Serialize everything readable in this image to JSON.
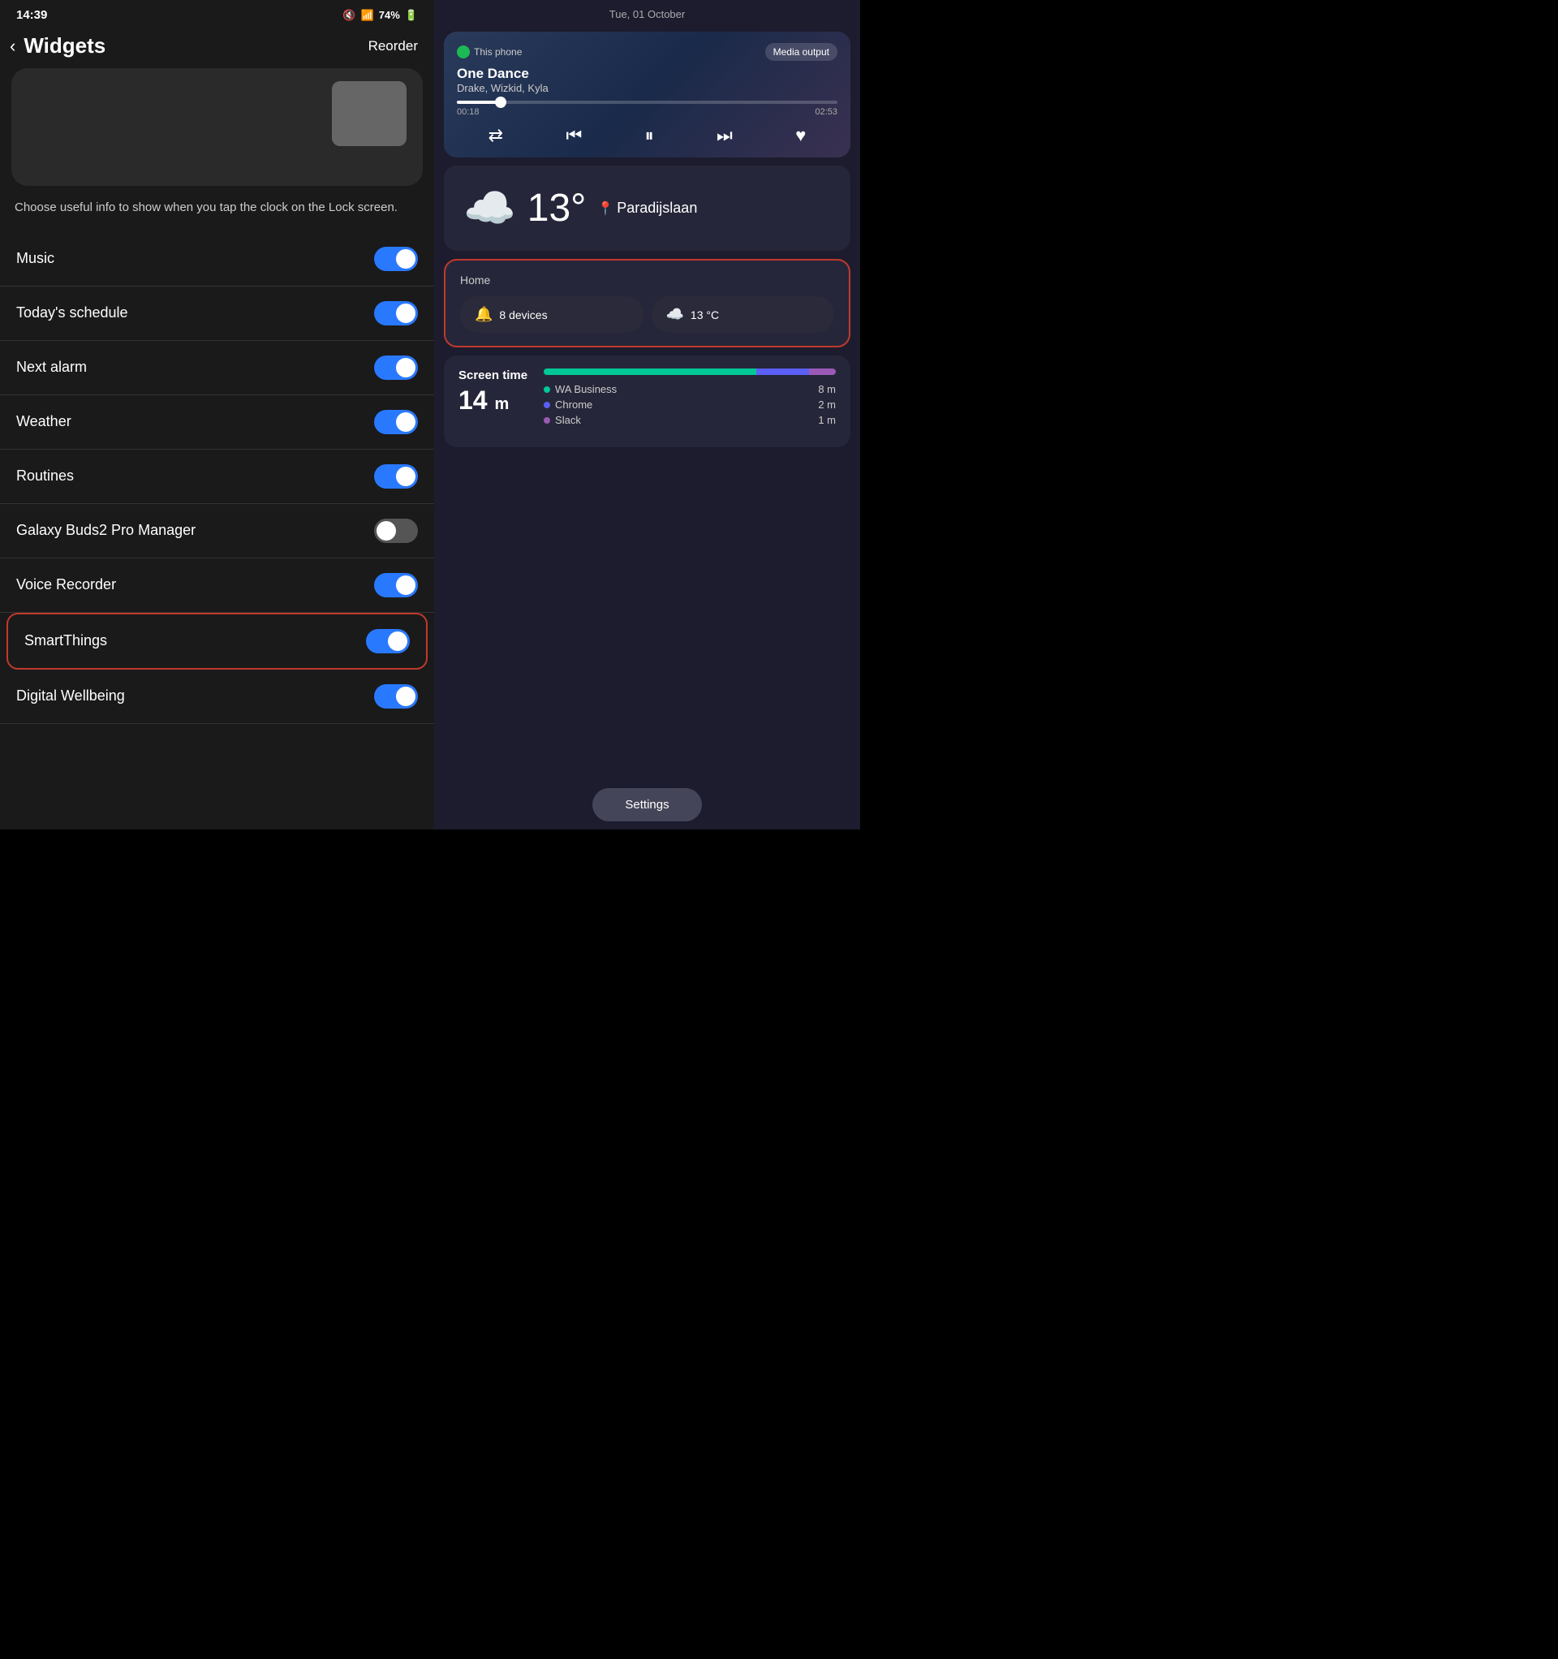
{
  "statusBar": {
    "time": "14:39",
    "battery": "74%",
    "batteryIcon": "🔋"
  },
  "leftPanel": {
    "backLabel": "‹",
    "title": "Widgets",
    "reorderLabel": "Reorder",
    "description": "Choose useful info to show when you tap the clock on the Lock screen.",
    "widgets": [
      {
        "id": "music",
        "label": "Music",
        "toggleOn": true
      },
      {
        "id": "todays-schedule",
        "label": "Today's schedule",
        "toggleOn": true
      },
      {
        "id": "next-alarm",
        "label": "Next alarm",
        "toggleOn": true
      },
      {
        "id": "weather",
        "label": "Weather",
        "toggleOn": true
      },
      {
        "id": "routines",
        "label": "Routines",
        "toggleOn": true
      },
      {
        "id": "galaxy-buds",
        "label": "Galaxy Buds2 Pro Manager",
        "toggleOn": false
      },
      {
        "id": "voice-recorder",
        "label": "Voice Recorder",
        "toggleOn": true
      },
      {
        "id": "smartthings",
        "label": "SmartThings",
        "toggleOn": true,
        "highlighted": true
      },
      {
        "id": "digital-wellbeing",
        "label": "Digital Wellbeing",
        "toggleOn": true
      }
    ]
  },
  "rightPanel": {
    "dateHeader": "Tue, 01 October",
    "musicCard": {
      "source": "This phone",
      "mediaOutputLabel": "Media output",
      "songTitle": "One Dance",
      "artist": "Drake, Wizkid, Kyla",
      "timeElapsed": "00:18",
      "timeDuration": "02:53",
      "progressPercent": 11
    },
    "weatherCard": {
      "temperature": "13°",
      "location": "Paradijslaan"
    },
    "homeCard": {
      "title": "Home",
      "devices": "8 devices",
      "tempLabel": "13 °C",
      "highlighted": true
    },
    "screenTimeCard": {
      "label": "Screen time",
      "value": "14",
      "unit": "m",
      "apps": [
        {
          "name": "WA Business",
          "time": "8 m",
          "color": "#00c896"
        },
        {
          "name": "Chrome",
          "time": "2 m",
          "color": "#5b5ff5"
        },
        {
          "name": "Slack",
          "time": "1 m",
          "color": "#9b59b6"
        }
      ]
    },
    "settingsLabel": "Settings"
  }
}
